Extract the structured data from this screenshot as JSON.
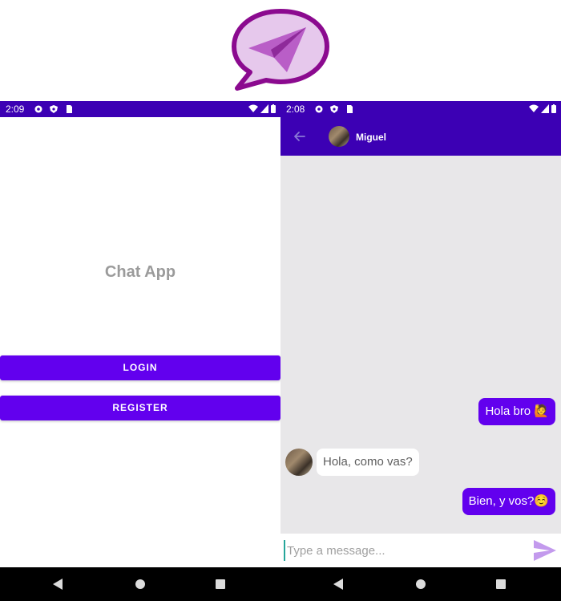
{
  "logo": {
    "name": "chat-app-logo",
    "colors": {
      "outline": "#8b0a8f",
      "fill": "#e6c8ec",
      "plane": "#b95ec7"
    }
  },
  "left": {
    "statusbar": {
      "time": "2:09"
    },
    "title": "Chat App",
    "login_label": "LOGIN",
    "register_label": "REGISTER"
  },
  "right": {
    "statusbar": {
      "time": "2:08"
    },
    "contact": {
      "name": "Miguel"
    },
    "messages": [
      {
        "from": "me",
        "text": "Hola bro 🙋"
      },
      {
        "from": "Miguel",
        "text": "Hola, como vas?"
      },
      {
        "from": "me",
        "text": "Bien, y vos?☺️"
      }
    ],
    "input": {
      "placeholder": "Type a message...",
      "value": ""
    }
  },
  "colors": {
    "primary": "#6200ee",
    "primary_dark": "#3c00b4",
    "chat_bg": "#e8e7e9",
    "send": "#c39aed"
  }
}
